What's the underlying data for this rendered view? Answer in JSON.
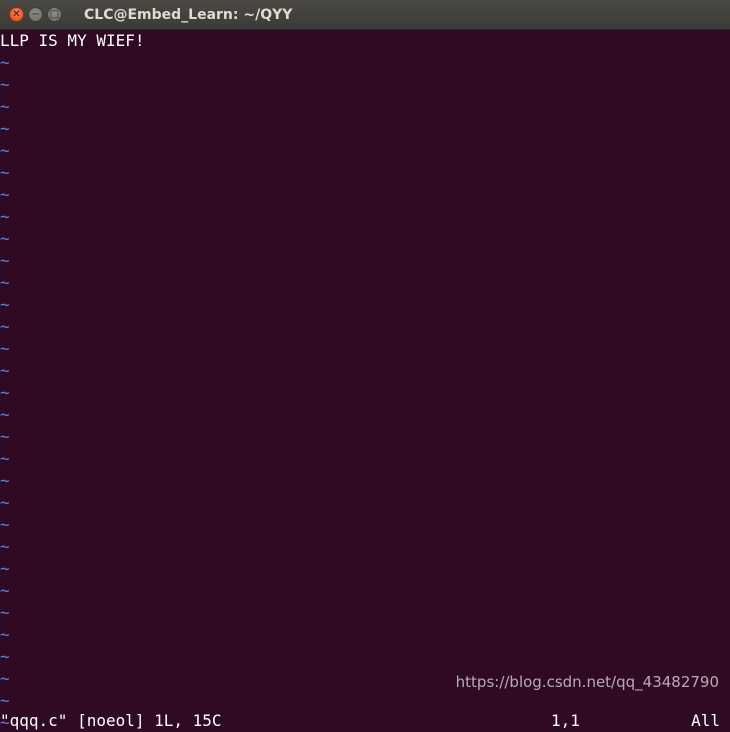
{
  "window": {
    "title": "CLC@Embed_Learn: ~/QYY",
    "controls": {
      "close_glyph": "✕",
      "minimize_glyph": "−",
      "maximize_glyph": "□"
    }
  },
  "editor": {
    "content_line": "LLP IS MY WIEF!",
    "tilde_glyph": "~",
    "tilde_color": "#5f87d7",
    "background_color": "#300a24",
    "tilde_rows": [
      "~",
      "~",
      "~",
      "~",
      "~",
      "~",
      "~",
      "~",
      "~",
      "~",
      "~",
      "~",
      "~",
      "~",
      "~",
      "~",
      "~",
      "~",
      "~",
      "~",
      "~",
      "~",
      "~",
      "~",
      "~",
      "~",
      "~",
      "~",
      "~",
      "~",
      "~"
    ]
  },
  "status_line": {
    "file_info": "\"qqq.c\" [noeol] 1L, 15C",
    "cursor_position": "1,1",
    "scroll_position": "All"
  },
  "watermark": {
    "text": "https://blog.csdn.net/qq_43482790"
  }
}
